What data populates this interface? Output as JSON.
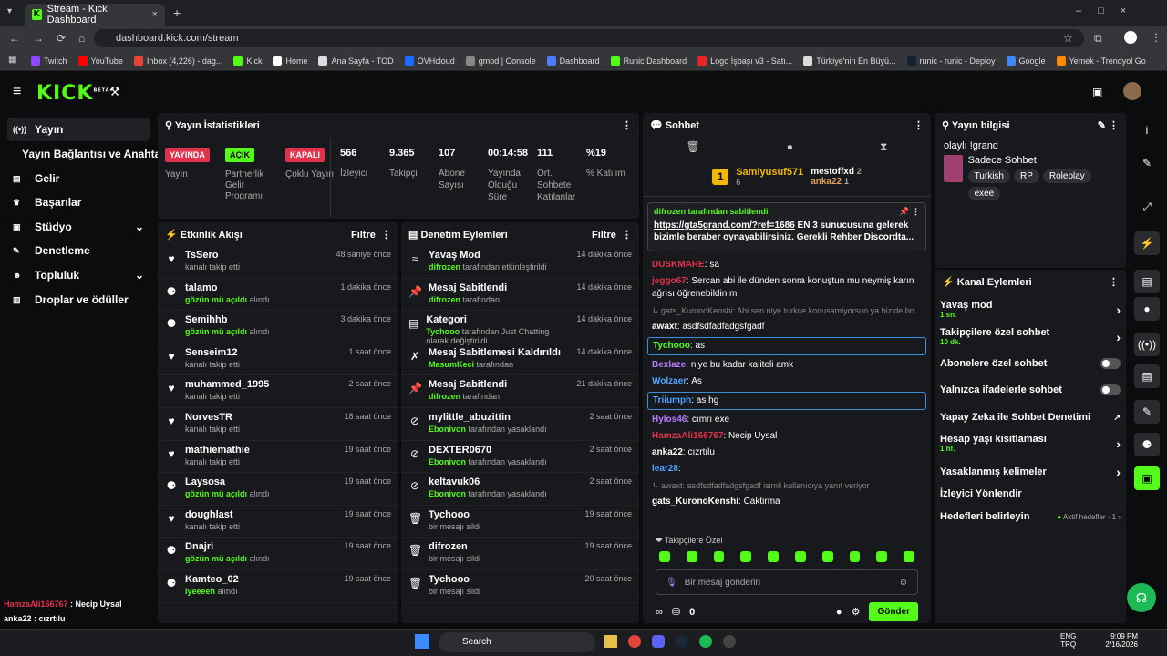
{
  "browser": {
    "tab_title": "Stream - Kick Dashboard",
    "url": "dashboard.kick.com/stream"
  },
  "bookmarks": [
    "Twitch",
    "YouTube",
    "Inbox (4,226) - dag...",
    "Kick",
    "Home",
    "Ana Sayfa - TOD",
    "OVHcloud",
    "gmod | Console",
    "Dashboard",
    "Runic Dashboard",
    "Logo İşbaşı v3 - Satı...",
    "Türkiye'nin En Büyü...",
    "runic - runic - Deploy",
    "Google",
    "Yemek - Trendyol Go"
  ],
  "header": {
    "logo": "KICK",
    "beta": "BETA"
  },
  "sidebar": {
    "items": [
      "Yayın",
      "Yayın Bağlantısı ve Anahtarı",
      "Gelir",
      "Başarılar",
      "Stüdyo",
      "Denetleme",
      "Topluluk",
      "Droplar ve ödüller"
    ]
  },
  "stats": {
    "title": "Yayın İstatistikleri",
    "badges": [
      {
        "label": "YAYINDA",
        "sub": "Yayın"
      },
      {
        "label": "AÇIK",
        "sub": "Partnerlik Gelir Programı"
      },
      {
        "label": "KAPALI",
        "sub": "Çoklu Yayın"
      }
    ],
    "items": [
      {
        "v": "566",
        "l": "İzleyici"
      },
      {
        "v": "9.365",
        "l": "Takipçi"
      },
      {
        "v": "107",
        "l": "Abone Sayısı"
      },
      {
        "v": "00:14:58",
        "l": "Yayında Olduğu Süre"
      },
      {
        "v": "111",
        "l": "Ort. Sohbete Katılanlar"
      },
      {
        "v": "%19",
        "l": "% Katılım"
      }
    ]
  },
  "activity": {
    "title": "Etkinlik Akışı",
    "filter": "Filtre",
    "rows": [
      {
        "name": "TsSero",
        "desc": "kanalı takip etti",
        "hl": "",
        "when": "48 saniye önce"
      },
      {
        "name": "talamo",
        "desc": "alındı",
        "hl": "gözün mü açıldı",
        "when": "1 dakika önce"
      },
      {
        "name": "Semihhb",
        "desc": "alındı",
        "hl": "gözün mü açıldı",
        "when": "3 dakika önce"
      },
      {
        "name": "Senseim12",
        "desc": "kanalı takip etti",
        "hl": "",
        "when": "1 saat önce"
      },
      {
        "name": "muhammed_1995",
        "desc": "kanalı takip etti",
        "hl": "",
        "when": "2 saat önce"
      },
      {
        "name": "NorvesTR",
        "desc": "kanalı takip etti",
        "hl": "",
        "when": "18 saat önce"
      },
      {
        "name": "mathiemathie",
        "desc": "kanalı takip etti",
        "hl": "",
        "when": "19 saat önce"
      },
      {
        "name": "Laysosa",
        "desc": "alındı",
        "hl": "gözün mü açıldı",
        "when": "19 saat önce"
      },
      {
        "name": "doughlast",
        "desc": "kanalı takip etti",
        "hl": "",
        "when": "19 saat önce"
      },
      {
        "name": "Dnajri",
        "desc": "alındı",
        "hl": "gözün mü açıldı",
        "when": "19 saat önce"
      },
      {
        "name": "Kamteo_02",
        "desc": "alındı",
        "hl": "iyeeeeh",
        "when": "19 saat önce"
      }
    ]
  },
  "mod": {
    "title": "Denetim Eylemleri",
    "filter": "Filtre",
    "rows": [
      {
        "name": "Yavaş Mod",
        "hl": "difrozen",
        "desc": "tarafından etkinleştirildi",
        "when": "14 dakika önce"
      },
      {
        "name": "Mesaj Sabitlendi",
        "hl": "difrozen",
        "desc": "tarafından",
        "when": "14 dakika önce"
      },
      {
        "name": "Kategori",
        "hl": "Tychooo",
        "desc": "tarafından Just Chatting olarak değiştirildi",
        "when": "14 dakika önce"
      },
      {
        "name": "Mesaj Sabitlemesi Kaldırıldı",
        "hl": "MasumKeci",
        "desc": "tarafından",
        "when": "14 dakika önce"
      },
      {
        "name": "Mesaj Sabitlendi",
        "hl": "difrozen",
        "desc": "tarafından",
        "when": "21 dakika önce"
      },
      {
        "name": "mylittle_abuzittin",
        "hl": "Ebonivon",
        "desc": "tarafından yasaklandı",
        "when": "2 saat önce"
      },
      {
        "name": "DEXTER0670",
        "hl": "Ebonivon",
        "desc": "tarafından yasaklandı",
        "when": "2 saat önce"
      },
      {
        "name": "keltavuk06",
        "hl": "Ebonivon",
        "desc": "tarafından yasaklandı",
        "when": "2 saat önce"
      },
      {
        "name": "Tychooo",
        "hl": "",
        "desc": "bir mesajı sildi",
        "when": "19 saat önce"
      },
      {
        "name": "difrozen",
        "hl": "",
        "desc": "bir mesajı sildi",
        "when": "19 saat önce"
      },
      {
        "name": "Tychooo",
        "hl": "",
        "desc": "bir mesajı sildi",
        "when": "20 saat önce"
      }
    ]
  },
  "chat": {
    "title": "Sohbet",
    "leaders": {
      "first": "Samiyusuf571",
      "first_n": "6",
      "second": "mestoffxd",
      "second_n": "2",
      "third": "anka22",
      "third_n": "1"
    },
    "pinned": {
      "by": "difrozen tarafından sabitlendi",
      "link": "https://gta5grand.com/?ref=1686",
      "text": " EN 3 sunucusuna gelerek bizimle beraber oynayabilirsiniz. Gerekli Rehber Discordta..."
    },
    "messages": [
      {
        "u": "DUSKMARE",
        "c": "#e0324b",
        "m": "sa"
      },
      {
        "u": "jeggo67",
        "c": "#e0324b",
        "m": "Sercan abi ile dünden sonra konuştun mu neymiş karın ağrısı öğrenebildin mi"
      },
      {
        "u": "",
        "c": "#888",
        "m": "gats_KuronoKenshi: Abi sen niye turkce konusamiyorsun ya bizide bo..."
      },
      {
        "u": "awaxt",
        "c": "#fff",
        "m": "asdfsdfadfadgsfgadf"
      },
      {
        "u": "Tychooo",
        "c": "#53fc18",
        "m": "as"
      },
      {
        "u": "Bexlaze",
        "c": "#b57bff",
        "m": "niye bu kadar kaliteli amk"
      },
      {
        "u": "Wolzaer",
        "c": "#4fa3ff",
        "m": "As"
      },
      {
        "u": "Triiumph",
        "c": "#4fa3ff",
        "m": "as hg"
      },
      {
        "u": "Hylos46",
        "c": "#b57bff",
        "m": "cımrı exe"
      },
      {
        "u": "HamzaAli166767",
        "c": "#e0324b",
        "m": "Necip Uysal"
      },
      {
        "u": "anka22",
        "c": "#fff",
        "m": "cızrtılu"
      },
      {
        "u": "lear28",
        "c": "#4fa3ff",
        "m": ""
      },
      {
        "u": "",
        "c": "#888",
        "m": "awaxt: asdfsdfadfadgsfgadf isimli kullanıcıya yanıt veriyor"
      },
      {
        "u": "gats_KuronoKenshi",
        "c": "#fff",
        "m": "Caktirma"
      }
    ],
    "subs_label": "Takipçilere Özel",
    "input_placeholder": "Bir mesaj gönderin",
    "points": "0",
    "send": "Gönder"
  },
  "info": {
    "title": "Yayın bilgisi",
    "stream_title": "olaylı !grand",
    "category": "Sadece Sohbet",
    "tags": [
      "Turkish",
      "RP",
      "Roleplay",
      "exee"
    ]
  },
  "channel": {
    "title": "Kanal Eylemleri",
    "rows": [
      {
        "label": "Yavaş mod",
        "sub": "1 sn."
      },
      {
        "label": "Takipçilere özel sohbet",
        "sub": "10 dk."
      },
      {
        "label": "Abonelere özel sohbet",
        "sub": ""
      },
      {
        "label": "Yalnızca ifadelerle sohbet",
        "sub": ""
      },
      {
        "label": "Yapay Zeka ile Sohbet Denetimi",
        "sub": ""
      },
      {
        "label": "Hesap yaşı kısıtlaması",
        "sub": "1 hf."
      },
      {
        "label": "Yasaklanmış kelimeler",
        "sub": ""
      },
      {
        "label": "İzleyici Yönlendir",
        "sub": ""
      },
      {
        "label": "Hedefleri belirleyin",
        "sub": ""
      }
    ],
    "goals_status": "Aktif hedefler - 1"
  },
  "overlay": [
    {
      "u": "HamzaAli166767",
      "m": "Necip Uysal"
    },
    {
      "u": "anka22",
      "m": "cızrtılu"
    },
    {
      "u": "lear28",
      "m": ""
    },
    {
      "u": "gats_KuronoKenshi",
      "m": "Caktirma"
    }
  ],
  "taskbar": {
    "search": "Search",
    "lang1": "ENG",
    "lang2": "TRQ",
    "time": "9:09 PM",
    "date": "2/16/2026"
  }
}
